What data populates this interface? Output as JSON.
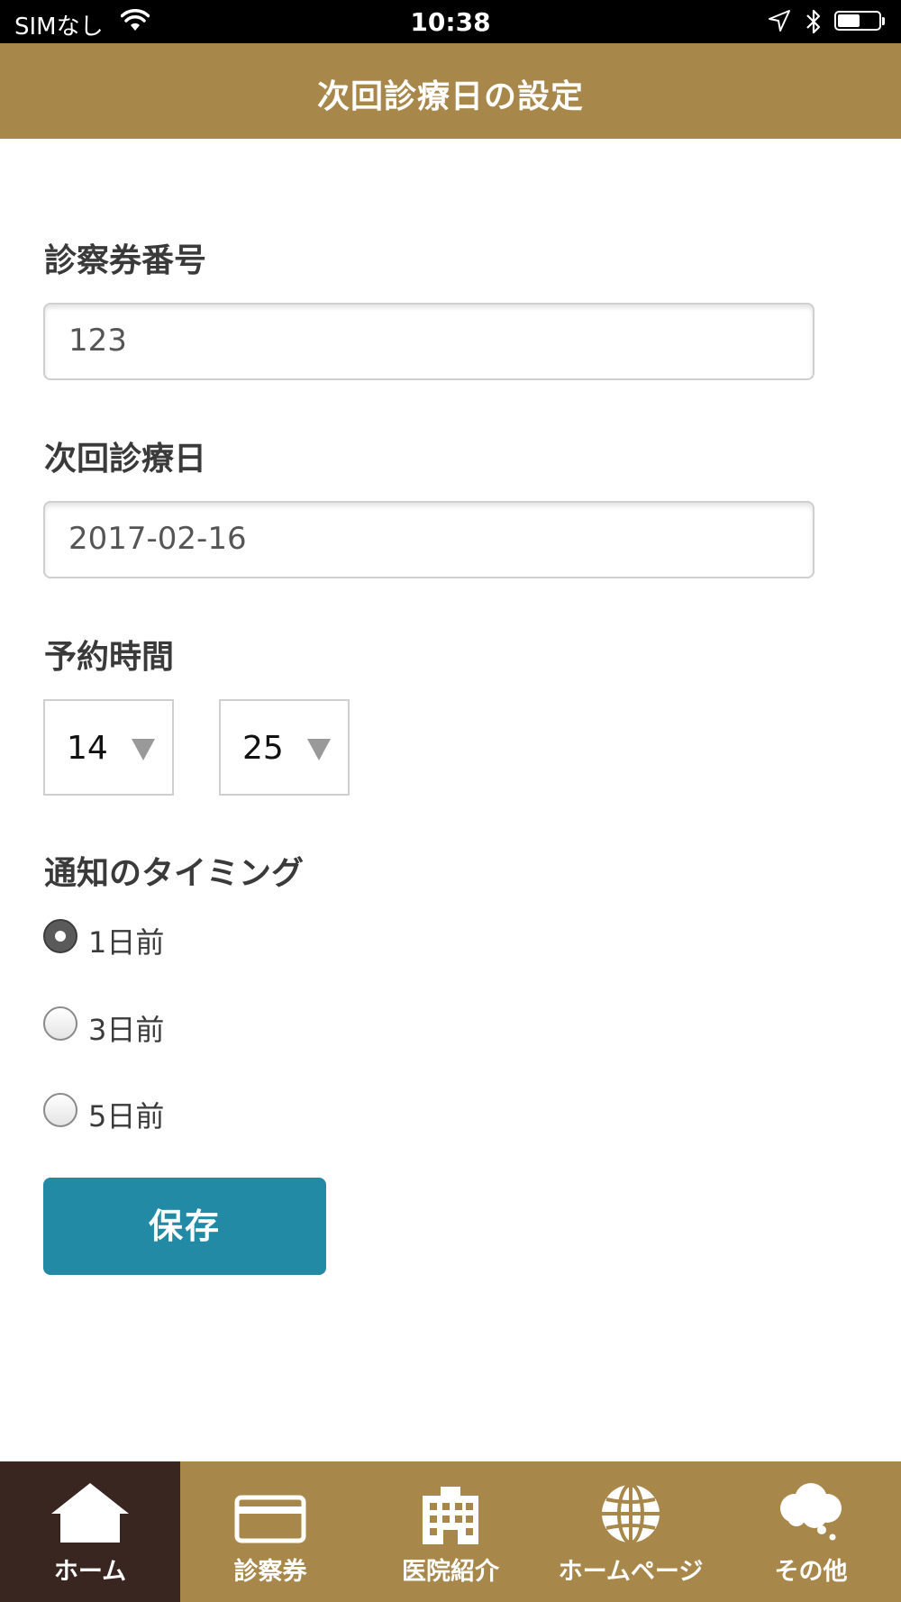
{
  "status_bar": {
    "carrier": "SIMなし",
    "time": "10:38",
    "battery_level": 0.55
  },
  "header": {
    "title": "次回診療日の設定"
  },
  "form": {
    "card_number": {
      "label": "診察券番号",
      "value": "123"
    },
    "next_visit": {
      "label": "次回診療日",
      "value": "2017-02-16"
    },
    "reservation_time": {
      "label": "予約時間",
      "hour": "14",
      "minute": "25"
    },
    "notification": {
      "label": "通知のタイミング",
      "options": [
        {
          "label": "1日前",
          "checked": true
        },
        {
          "label": "3日前",
          "checked": false
        },
        {
          "label": "5日前",
          "checked": false
        }
      ]
    },
    "save_label": "保存"
  },
  "tab_bar": {
    "items": [
      {
        "label": "ホーム",
        "icon": "home-icon",
        "active": true
      },
      {
        "label": "診察券",
        "icon": "card-icon",
        "active": false
      },
      {
        "label": "医院紹介",
        "icon": "building-icon",
        "active": false
      },
      {
        "label": "ホームページ",
        "icon": "globe-icon",
        "active": false
      },
      {
        "label": "その他",
        "icon": "cloud-icon",
        "active": false
      }
    ]
  },
  "colors": {
    "brand_gold": "#a8884a",
    "active_tab": "#3a2620",
    "save_button": "#238aa6",
    "status_bar": "#000000"
  }
}
